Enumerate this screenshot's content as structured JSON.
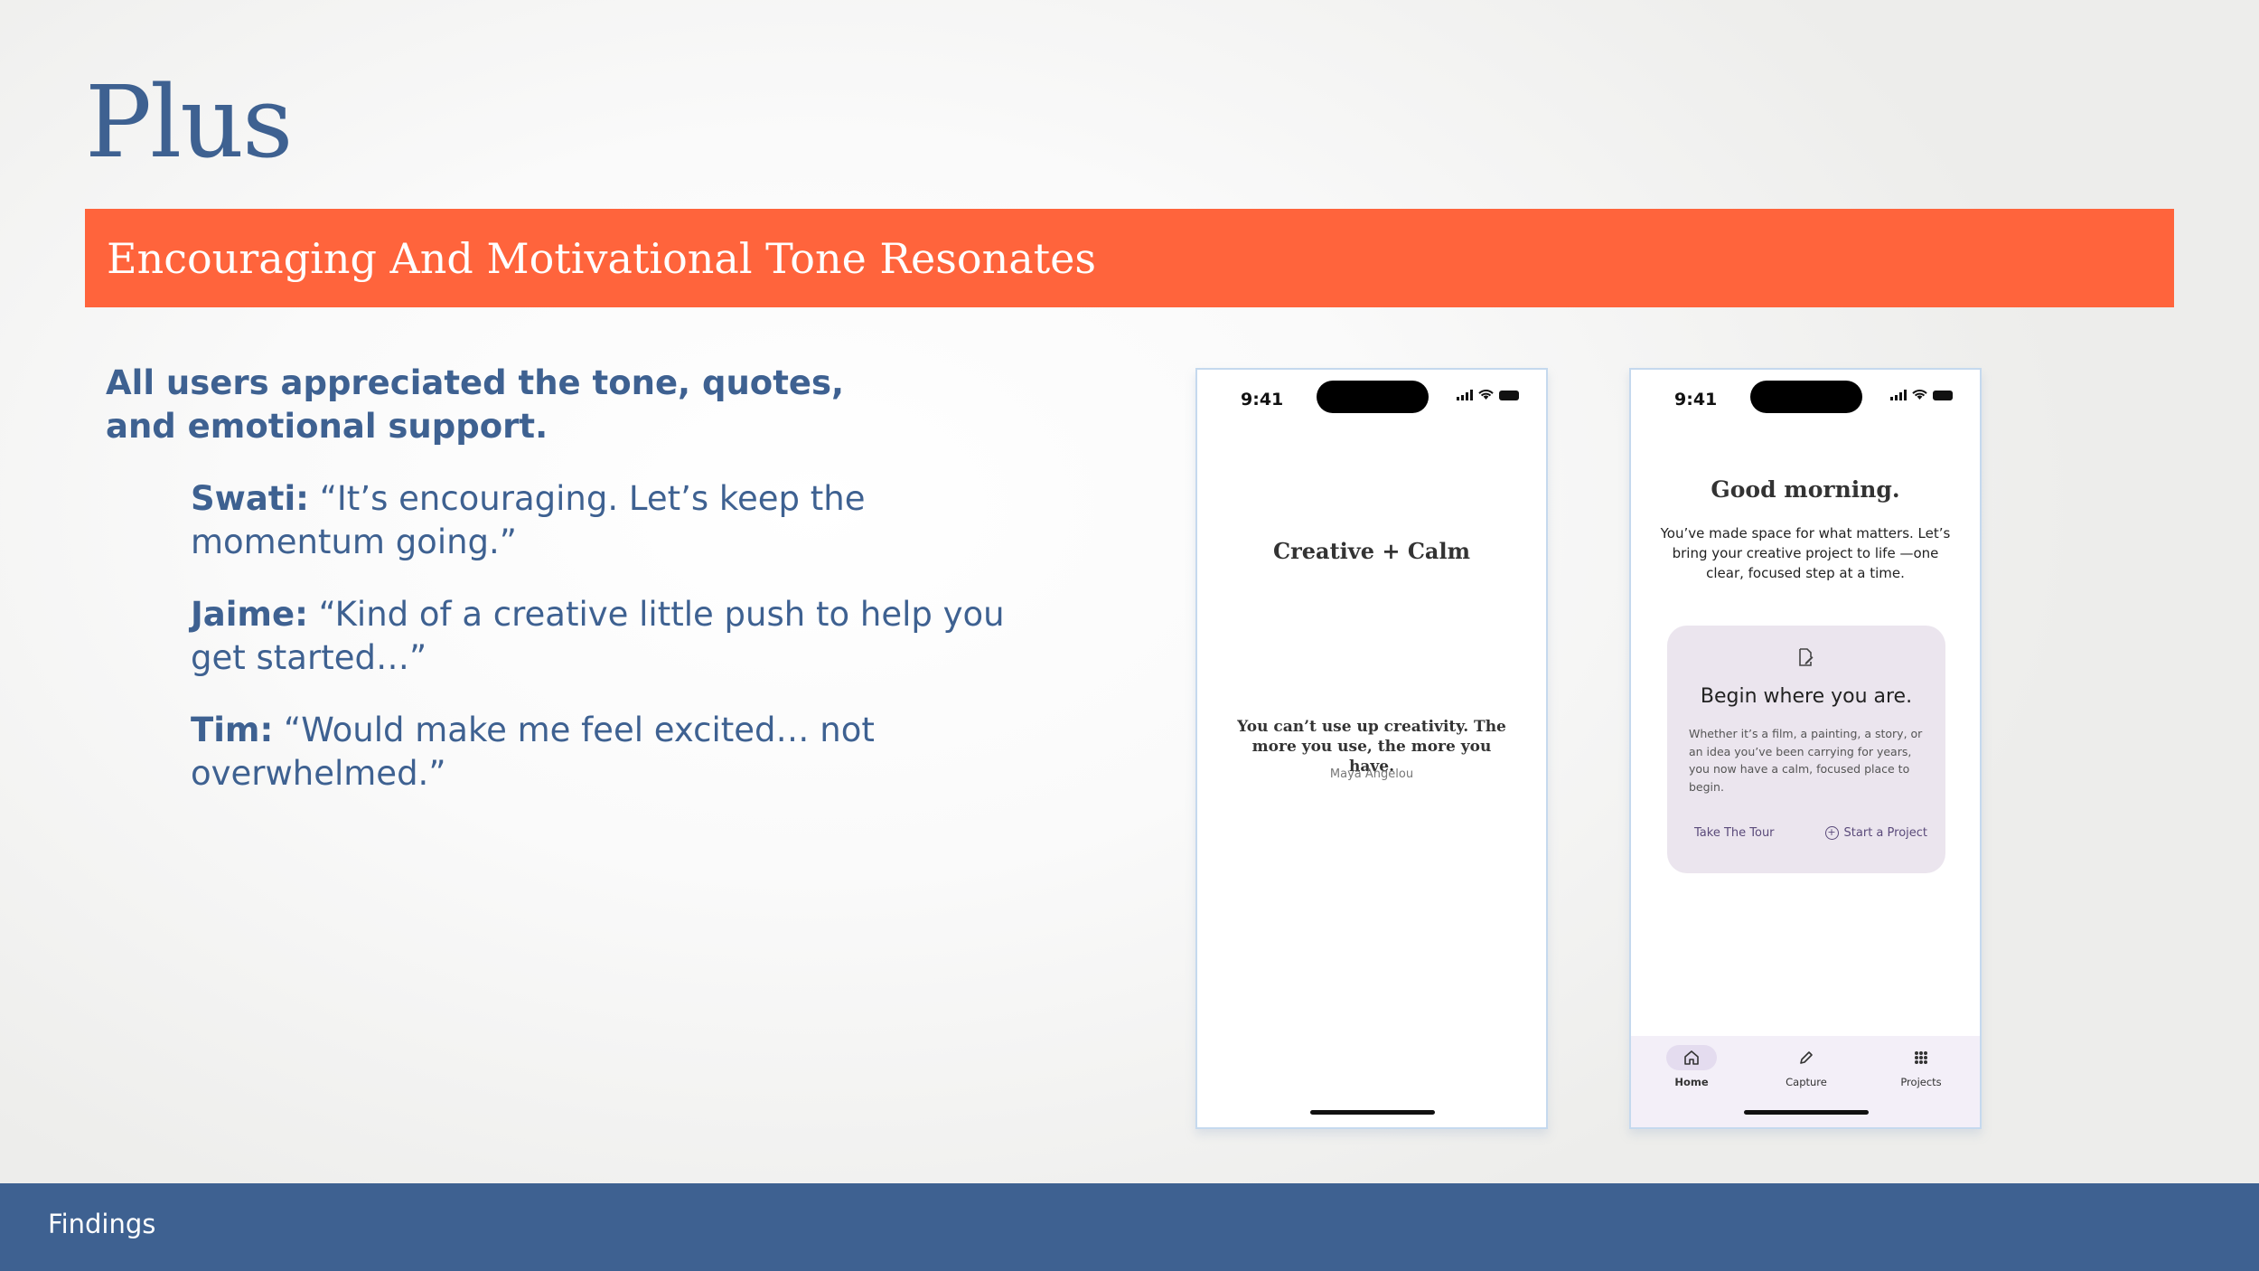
{
  "slide": {
    "title": "Plus",
    "banner": "Encouraging And Motivational Tone Resonates",
    "lead": "All users appreciated the tone, quotes, and emotional support.",
    "quotes": [
      {
        "speaker": "Swati:",
        "text": " “It’s encouraging. Let’s keep the momentum going.”"
      },
      {
        "speaker": "Jaime:",
        "text": " “Kind of a creative little push to help you get started…”"
      },
      {
        "speaker": "Tim:",
        "text": " “Would make me feel excited… not overwhelmed.”"
      }
    ],
    "footer": "Findings"
  },
  "phone1": {
    "time": "9:41",
    "app_name": "Creative + Calm",
    "quote": "You can’t use up creativity. The more you use, the more you have.",
    "author": "Maya Angelou"
  },
  "phone2": {
    "time": "9:41",
    "greeting": "Good morning.",
    "subtext": "You’ve made space for what matters. Let’s bring your creative project to life —one clear, focused step at a time.",
    "card": {
      "title": "Begin where you are.",
      "text": "Whether it’s a film, a painting, a story, or an idea you’ve been carrying for years, you now have a calm, focused place to begin.",
      "tour_label": "Take The Tour",
      "start_label": "Start a Project"
    },
    "nav": {
      "home": "Home",
      "capture": "Capture",
      "projects": "Projects"
    }
  },
  "colors": {
    "accent": "#ff643c",
    "brand": "#3e6191"
  }
}
